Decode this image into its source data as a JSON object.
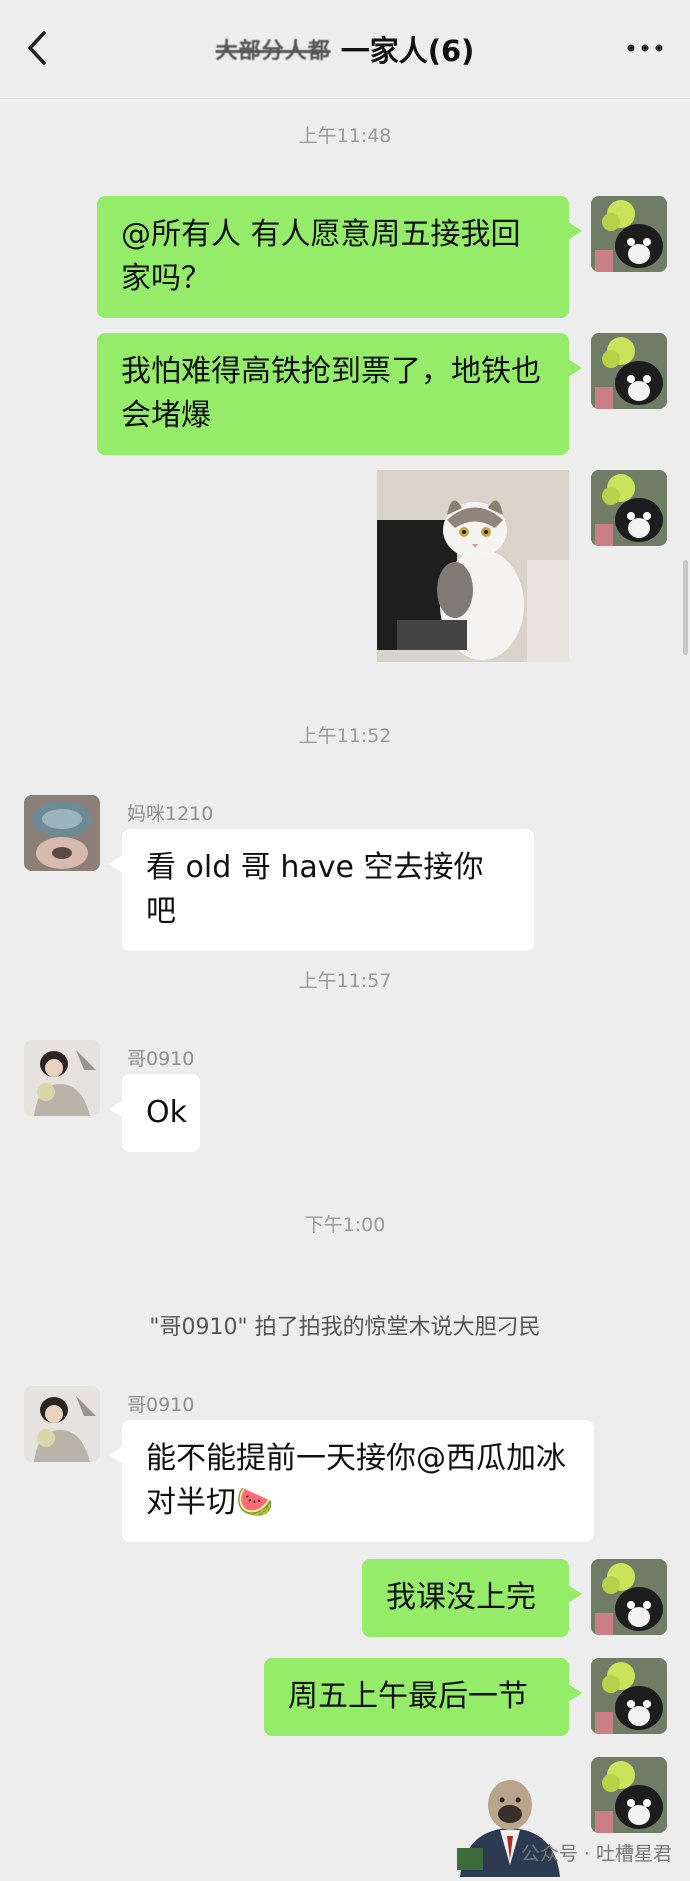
{
  "header": {
    "title_prefix": "大部分人都",
    "title": "一家人(6)",
    "back_icon": "chevron-left-icon",
    "more_icon": "more-dots-icon"
  },
  "timestamps": [
    "上午11:48",
    "上午11:52",
    "上午11:57",
    "下午1:00"
  ],
  "messages": {
    "m1": "@所有人  有人愿意周五接我回家吗？",
    "m2": "我怕难得高铁抢到票了，地铁也会堵爆",
    "m3_sender": "妈咪1210",
    "m3": "看 old 哥 have 空去接你吧",
    "m4_sender": "哥0910",
    "m4": "Ok",
    "m5_sender": "哥0910",
    "m5": "能不能提前一天接你@西瓜加冰对半切🍉",
    "m6": "我课没上完",
    "m7": "周五上午最后一节"
  },
  "system": {
    "pat": "\"哥0910\" 拍了拍我的惊堂木说大胆刁民"
  },
  "watermark": "公众号 · 吐槽星君",
  "colors": {
    "background": "#ededed",
    "outgoing_bubble": "#95ec69",
    "incoming_bubble": "#ffffff",
    "timestamp": "#9a9a9a"
  }
}
